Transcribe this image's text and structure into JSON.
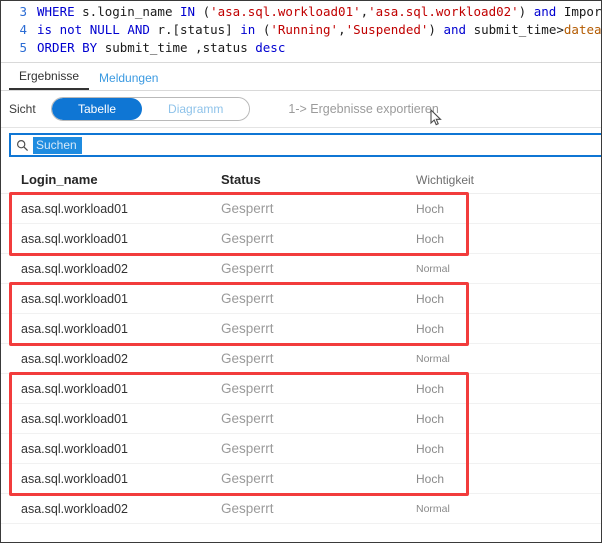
{
  "editor": {
    "lines": [
      {
        "number": "3",
        "tokens": [
          {
            "t": "WHERE ",
            "c": "kw"
          },
          {
            "t": "s.login_name ",
            "c": "id"
          },
          {
            "t": "IN ",
            "c": "kw"
          },
          {
            "t": "(",
            "c": "id"
          },
          {
            "t": "'asa.sql.workload01'",
            "c": "str"
          },
          {
            "t": ",",
            "c": "id"
          },
          {
            "t": "'asa.sql.workload02'",
            "c": "str"
          },
          {
            "t": ") ",
            "c": "id"
          },
          {
            "t": "and ",
            "c": "kw"
          },
          {
            "t": "Importanc",
            "c": "id"
          }
        ]
      },
      {
        "number": "4",
        "tokens": [
          {
            "t": "is not ",
            "c": "kw"
          },
          {
            "t": "NULL ",
            "c": "kw"
          },
          {
            "t": "AND ",
            "c": "kw"
          },
          {
            "t": "r.[status] ",
            "c": "id"
          },
          {
            "t": "in ",
            "c": "kw"
          },
          {
            "t": "(",
            "c": "id"
          },
          {
            "t": "'Running'",
            "c": "str"
          },
          {
            "t": ",",
            "c": "id"
          },
          {
            "t": "'Suspended'",
            "c": "str"
          },
          {
            "t": ") ",
            "c": "id"
          },
          {
            "t": "and ",
            "c": "kw"
          },
          {
            "t": "submit_time>",
            "c": "id"
          },
          {
            "t": "dateadd(m",
            "c": "fn"
          }
        ]
      },
      {
        "number": "5",
        "tokens": [
          {
            "t": "ORDER BY ",
            "c": "kw"
          },
          {
            "t": "submit_time ,status ",
            "c": "id"
          },
          {
            "t": "desc",
            "c": "kw"
          }
        ]
      }
    ]
  },
  "result_tabs": [
    {
      "label": "Ergebnisse",
      "active": true
    },
    {
      "label": "Meldungen",
      "active": false
    }
  ],
  "view_bar": {
    "sicht_label": "Sicht",
    "toggle": [
      {
        "label": "Tabelle",
        "selected": true
      },
      {
        "label": "Diagramm",
        "selected": false
      }
    ],
    "export_label": "1-> Ergebnisse exportieren"
  },
  "search": {
    "placeholder": "Suchen",
    "icon": "search-icon"
  },
  "table": {
    "columns": [
      "Login_name",
      "Status",
      "Wichtigkeit"
    ],
    "rows": [
      {
        "login_name": "asa.sql.workload01",
        "status": "Gesperrt",
        "wichtigkeit": "Hoch",
        "highlight": true
      },
      {
        "login_name": "asa.sql.workload01",
        "status": "Gesperrt",
        "wichtigkeit": "Hoch",
        "highlight": true
      },
      {
        "login_name": "asa.sql.workload02",
        "status": "Gesperrt",
        "wichtigkeit": "Normal",
        "highlight": false
      },
      {
        "login_name": "asa.sql.workload01",
        "status": "Gesperrt",
        "wichtigkeit": "Hoch",
        "highlight": true
      },
      {
        "login_name": "asa.sql.workload01",
        "status": "Gesperrt",
        "wichtigkeit": "Hoch",
        "highlight": true
      },
      {
        "login_name": "asa.sql.workload02",
        "status": "Gesperrt",
        "wichtigkeit": "Normal",
        "highlight": false
      },
      {
        "login_name": "asa.sql.workload01",
        "status": "Gesperrt",
        "wichtigkeit": "Hoch",
        "highlight": true
      },
      {
        "login_name": "asa.sql.workload01",
        "status": "Gesperrt",
        "wichtigkeit": "Hoch",
        "highlight": true
      },
      {
        "login_name": "asa.sql.workload01",
        "status": "Gesperrt",
        "wichtigkeit": "Hoch",
        "highlight": true
      },
      {
        "login_name": "asa.sql.workload01",
        "status": "Gesperrt",
        "wichtigkeit": "Hoch",
        "highlight": true
      },
      {
        "login_name": "asa.sql.workload02",
        "status": "Gesperrt",
        "wichtigkeit": "Normal",
        "highlight": false
      }
    ]
  },
  "colors": {
    "accent_blue": "#0f76d4",
    "highlight_red": "#f23c3c",
    "keyword_blue": "#0000d0",
    "string_red": "#c00000",
    "muted_gray": "#9a9a9a"
  }
}
